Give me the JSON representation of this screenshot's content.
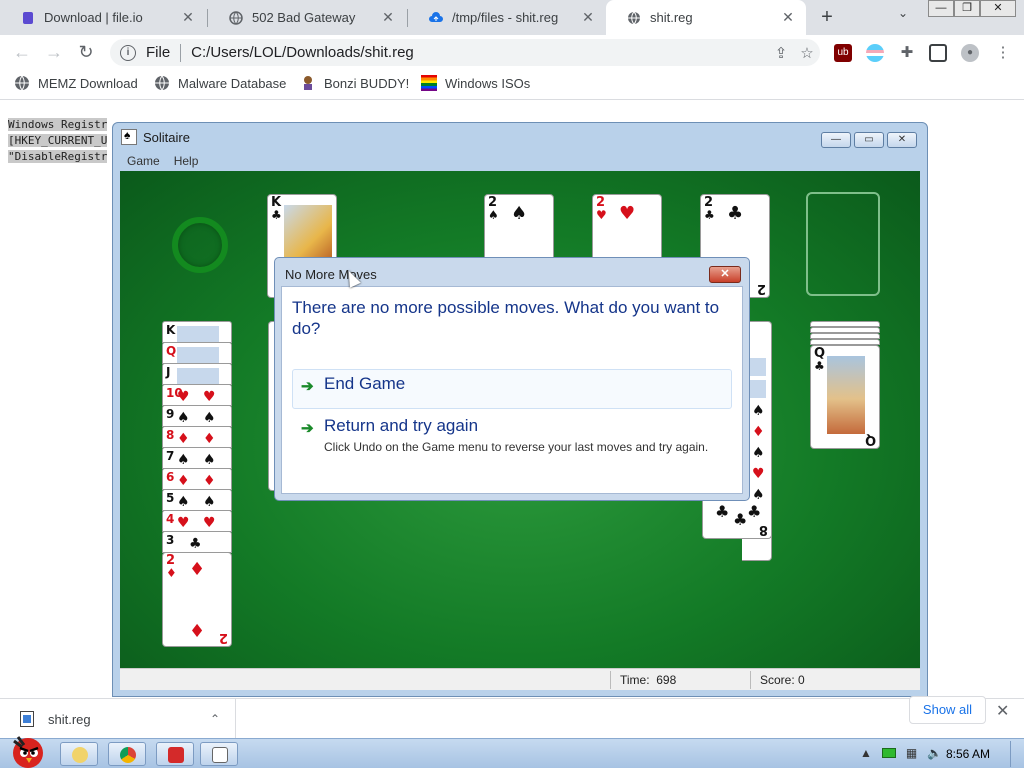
{
  "browser": {
    "tabs": [
      {
        "label": "Download | file.io",
        "active": false
      },
      {
        "label": "502 Bad Gateway",
        "active": false
      },
      {
        "label": "/tmp/files - shit.reg",
        "active": false
      },
      {
        "label": "shit.reg",
        "active": true
      }
    ],
    "new_tab_glyph": "+",
    "address": {
      "scheme": "File",
      "url": "C:/Users/LOL/Downloads/shit.reg"
    },
    "bookmarks": [
      {
        "label": "MEMZ Download",
        "icon": "globe-icon"
      },
      {
        "label": "Malware Database",
        "icon": "globe-icon"
      },
      {
        "label": "Bonzi BUDDY!",
        "icon": "bonzi-icon"
      },
      {
        "label": "Windows ISOs",
        "icon": "windows-icon"
      }
    ]
  },
  "page_text": {
    "line1": "Windows Registr",
    "line2": "[HKEY_CURRENT_U",
    "line3": "\"DisableRegistr"
  },
  "solitaire": {
    "title": "Solitaire",
    "menu": [
      "Game",
      "Help"
    ],
    "status": {
      "time_label": "Time:",
      "time_value": "698",
      "score_label": "Score:",
      "score_value": "0"
    }
  },
  "dialog": {
    "title": "No More Moves",
    "close_glyph": "✕",
    "message": "There are no more possible moves. What do you want to do?",
    "options": [
      {
        "label": "End Game",
        "description": ""
      },
      {
        "label": "Return and try again",
        "description": "Click Undo on the Game menu to reverse your last moves and try again."
      }
    ]
  },
  "downloads": {
    "file": "shit.reg",
    "show_all": "Show all"
  },
  "taskbar": {
    "clock": "8:56 AM"
  },
  "colors": {
    "felt": "#137a26",
    "dialog_text": "#15358a",
    "arrow": "#1a8a2a"
  }
}
